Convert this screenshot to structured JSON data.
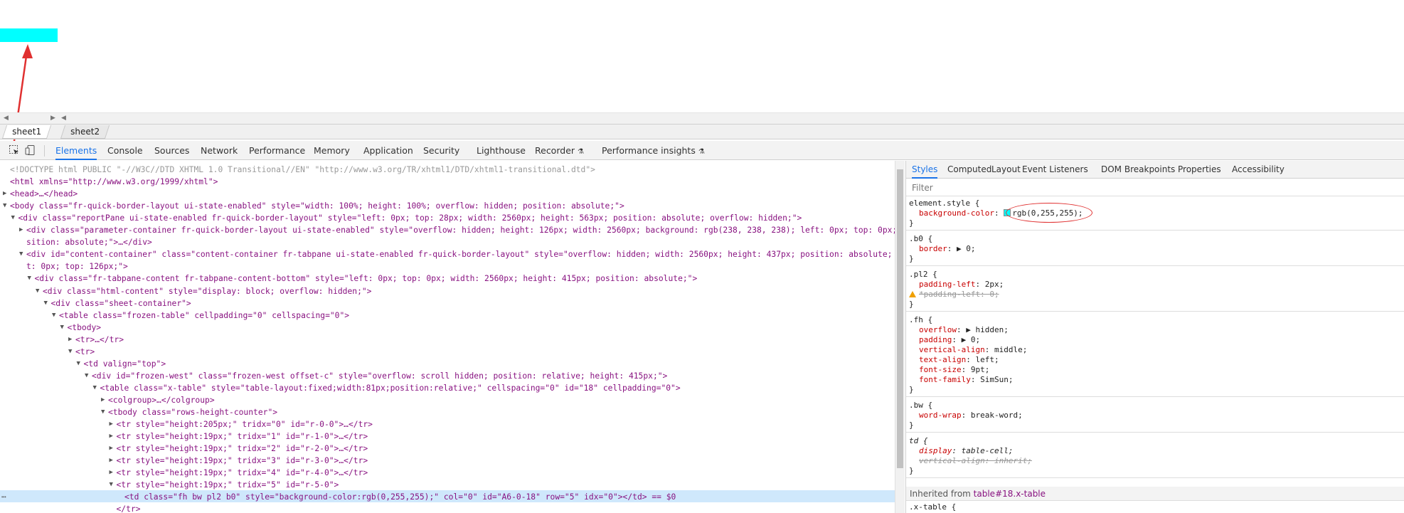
{
  "sheet_tabs": [
    "sheet1",
    "sheet2"
  ],
  "colors": {
    "cell_highlight": "#00ffff",
    "annotation_red": "#e03030",
    "devtools_accent": "#1a73e8"
  },
  "toolbar": {
    "tabs": [
      "Elements",
      "Console",
      "Sources",
      "Network",
      "Performance",
      "Memory",
      "Application",
      "Security",
      "Lighthouse",
      "Recorder",
      "Performance insights"
    ]
  },
  "dom_lines": [
    {
      "indent": 0,
      "tri": "",
      "html": "<!DOCTYPE html PUBLIC \"-//W3C//DTD XHTML 1.0 Transitional//EN\" \"http://www.w3.org/TR/xhtml1/DTD/xhtml1-transitional.dtd\">",
      "kind": "doctype"
    },
    {
      "indent": 0,
      "tri": "",
      "html": "<html xmlns=\"http://www.w3.org/1999/xhtml\">"
    },
    {
      "indent": 0,
      "tri": "▶",
      "html": "<head>…</head>"
    },
    {
      "indent": 0,
      "tri": "▼",
      "html": "<body class=\"fr-quick-border-layout ui-state-enabled\" style=\"width: 100%; height: 100%; overflow: hidden; position: absolute;\">"
    },
    {
      "indent": 1,
      "tri": "▼",
      "html": "<div class=\"reportPane ui-state-enabled fr-quick-border-layout\" style=\"left: 0px; top: 28px; width: 2560px; height: 563px; position: absolute; overflow: hidden;\">"
    },
    {
      "indent": 2,
      "tri": "▶",
      "html": "<div class=\"parameter-container fr-quick-border-layout ui-state-enabled\" style=\"overflow: hidden; height: 126px; width: 2560px; background: rgb(238, 238, 238); left: 0px; top: 0px; po"
    },
    {
      "indent": 2,
      "tri": "",
      "html": "sition: absolute;\">…</div>"
    },
    {
      "indent": 2,
      "tri": "▼",
      "html": "<div id=\"content-container\" class=\"content-container fr-tabpane ui-state-enabled fr-quick-border-layout\" style=\"overflow: hidden; width: 2560px; height: 437px; position: absolute; lef"
    },
    {
      "indent": 2,
      "tri": "",
      "html": "t: 0px; top: 126px;\">"
    },
    {
      "indent": 3,
      "tri": "▼",
      "html": "<div class=\"fr-tabpane-content fr-tabpane-content-bottom\" style=\"left: 0px; top: 0px; width: 2560px; height: 415px; position: absolute;\">"
    },
    {
      "indent": 4,
      "tri": "▼",
      "html": "<div class=\"html-content\" style=\"display: block; overflow: hidden;\">"
    },
    {
      "indent": 5,
      "tri": "▼",
      "html": "<div class=\"sheet-container\">"
    },
    {
      "indent": 6,
      "tri": "▼",
      "html": "<table class=\"frozen-table\" cellpadding=\"0\" cellspacing=\"0\">"
    },
    {
      "indent": 7,
      "tri": "▼",
      "html": "<tbody>"
    },
    {
      "indent": 8,
      "tri": "▶",
      "html": "<tr>…</tr>"
    },
    {
      "indent": 8,
      "tri": "▼",
      "html": "<tr>"
    },
    {
      "indent": 9,
      "tri": "▼",
      "html": "<td valign=\"top\">"
    },
    {
      "indent": 10,
      "tri": "▼",
      "html": "<div id=\"frozen-west\" class=\"frozen-west offset-c\" style=\"overflow: scroll hidden; position: relative; height: 415px;\">"
    },
    {
      "indent": 11,
      "tri": "▼",
      "html": "<table class=\"x-table\" style=\"table-layout:fixed;width:81px;position:relative;\" cellspacing=\"0\" id=\"18\" cellpadding=\"0\">"
    },
    {
      "indent": 12,
      "tri": "▶",
      "html": "<colgroup>…</colgroup>"
    },
    {
      "indent": 12,
      "tri": "▼",
      "html": "<tbody class=\"rows-height-counter\">"
    },
    {
      "indent": 13,
      "tri": "▶",
      "html": "<tr style=\"height:205px;\" tridx=\"0\" id=\"r-0-0\">…</tr>"
    },
    {
      "indent": 13,
      "tri": "▶",
      "html": "<tr style=\"height:19px;\" tridx=\"1\" id=\"r-1-0\">…</tr>"
    },
    {
      "indent": 13,
      "tri": "▶",
      "html": "<tr style=\"height:19px;\" tridx=\"2\" id=\"r-2-0\">…</tr>"
    },
    {
      "indent": 13,
      "tri": "▶",
      "html": "<tr style=\"height:19px;\" tridx=\"3\" id=\"r-3-0\">…</tr>"
    },
    {
      "indent": 13,
      "tri": "▶",
      "html": "<tr style=\"height:19px;\" tridx=\"4\" id=\"r-4-0\">…</tr>"
    },
    {
      "indent": 13,
      "tri": "▼",
      "html": "<tr style=\"height:19px;\" tridx=\"5\" id=\"r-5-0\">"
    },
    {
      "indent": 14,
      "tri": "",
      "html": "<td class=\"fh bw pl2 b0\" style=\"background-color:rgb(0,255,255);\" col=\"0\" id=\"A6-0-18\" row=\"5\" idx=\"0\"></td> == $0",
      "selected": true
    },
    {
      "indent": 13,
      "tri": "",
      "html": "</tr>"
    }
  ],
  "styles_tabs": [
    "Styles",
    "Computed",
    "Layout",
    "Event Listeners",
    "DOM Breakpoints",
    "Properties",
    "Accessibility"
  ],
  "filter_placeholder": "Filter",
  "rules": [
    {
      "selector": "element.style {",
      "props": [
        {
          "name": "background-color",
          "value": "rgb(0,255,255);",
          "swatch": true
        }
      ]
    },
    {
      "selector": ".b0 {",
      "props": [
        {
          "name": "border",
          "value": "▶ 0;"
        }
      ]
    },
    {
      "selector": ".pl2 {",
      "props": [
        {
          "name": "padding-left",
          "value": "2px;"
        },
        {
          "name": "*padding-left",
          "value": "0;",
          "strike": true,
          "warn": true
        }
      ]
    },
    {
      "selector": ".fh {",
      "props": [
        {
          "name": "overflow",
          "value": "▶ hidden;"
        },
        {
          "name": "padding",
          "value": "▶ 0;"
        },
        {
          "name": "vertical-align",
          "value": "middle;"
        },
        {
          "name": "text-align",
          "value": "left;"
        },
        {
          "name": "font-size",
          "value": "9pt;"
        },
        {
          "name": "font-family",
          "value": "SimSun;"
        }
      ]
    },
    {
      "selector": ".bw {",
      "props": [
        {
          "name": "word-wrap",
          "value": "break-word;"
        }
      ]
    },
    {
      "selector": "td {",
      "italic": true,
      "props": [
        {
          "name": "display",
          "value": "table-cell;"
        },
        {
          "name": "vertical-align",
          "value": "inherit;",
          "strike": true
        }
      ]
    }
  ],
  "inherited_label": "Inherited from ",
  "inherited_target": "table#18.x-table",
  "last_rule": ".x-table {"
}
